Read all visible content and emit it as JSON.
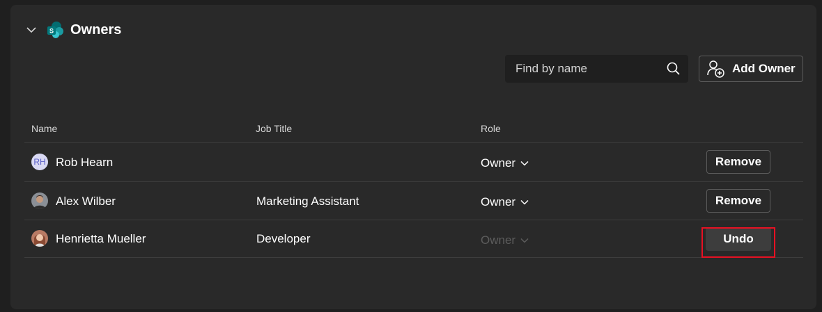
{
  "section": {
    "title": "Owners",
    "collapse_icon": "chevron-down-icon",
    "logo_icon": "sharepoint-logo-icon"
  },
  "toolbar": {
    "search_placeholder": "Find by name",
    "search_icon": "search-icon",
    "add_owner_label": "Add Owner",
    "add_owner_icon": "add-person-icon"
  },
  "table": {
    "columns": [
      "Name",
      "Job Title",
      "Role"
    ],
    "rows": [
      {
        "initials": "RH",
        "name": "Rob Hearn",
        "job_title": "",
        "role": "Owner",
        "action": "Remove",
        "role_enabled": true
      },
      {
        "initials": "",
        "name": "Alex Wilber",
        "job_title": "Marketing Assistant",
        "role": "Owner",
        "action": "Remove",
        "role_enabled": true
      },
      {
        "initials": "",
        "name": "Henrietta Mueller",
        "job_title": "Developer",
        "role": "Owner",
        "action": "Undo",
        "role_enabled": false
      }
    ]
  },
  "colors": {
    "background": "#1f1f1f",
    "panel": "#292929",
    "highlight": "#e81123",
    "disabled_text": "#5c5c5c"
  }
}
